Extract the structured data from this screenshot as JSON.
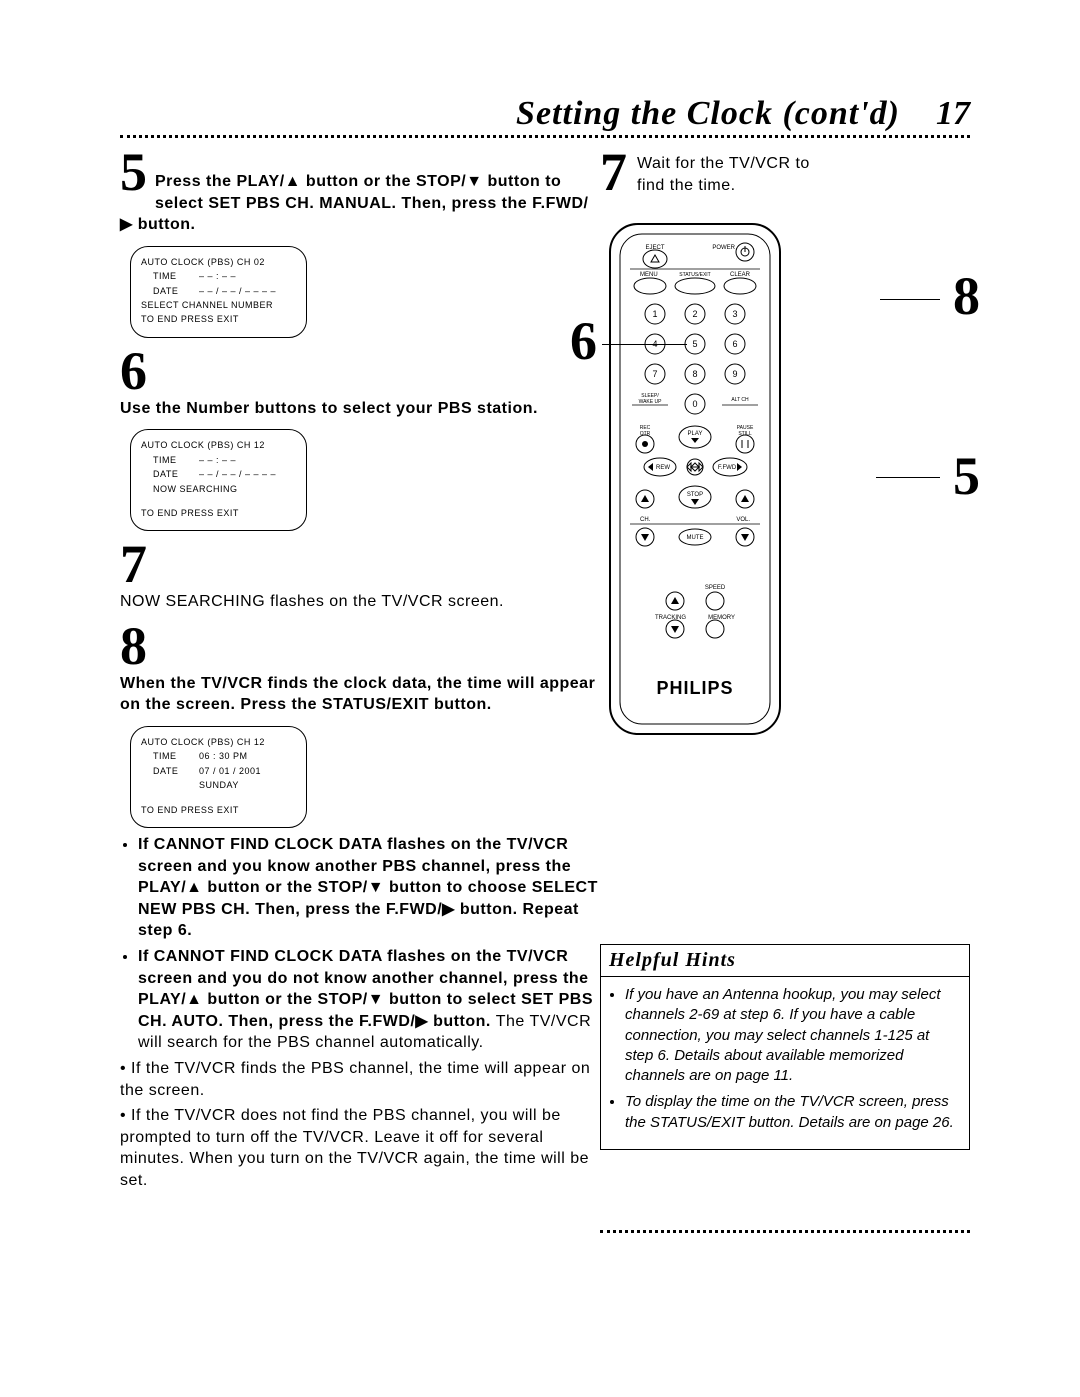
{
  "header": {
    "title": "Setting the Clock (cont'd)",
    "page_num": "17"
  },
  "step5": {
    "num": "5",
    "text": "Press the PLAY/▲ button or the STOP/▼ button to select SET PBS CH. MANUAL. Then, press the F.FWD/▶ button."
  },
  "osd5": {
    "line1": "AUTO CLOCK (PBS) CH 02",
    "time_label": "TIME",
    "time_val": "– – : – –",
    "date_label": "DATE",
    "date_val": "– – / – – / – – – –",
    "line4": "SELECT CHANNEL NUMBER",
    "line5": "TO END PRESS EXIT"
  },
  "step6": {
    "num": "6",
    "text": "Use the Number buttons to select your PBS station."
  },
  "osd6": {
    "line1": "AUTO CLOCK (PBS) CH 12",
    "time_label": "TIME",
    "time_val": "– – : – –",
    "date_label": "DATE",
    "date_val": "– – / – – / – – – –",
    "line4": "NOW SEARCHING",
    "line5": "TO END PRESS EXIT"
  },
  "step7": {
    "num": "7",
    "text": "NOW SEARCHING flashes on the TV/VCR screen."
  },
  "step8": {
    "num": "8",
    "text": "When the TV/VCR finds the clock data, the time will appear on the screen. Press the STATUS/EXIT button."
  },
  "osd8": {
    "line1": "AUTO CLOCK (PBS) CH 12",
    "time_label": "TIME",
    "time_val": "06 : 30 PM",
    "date_label": "DATE",
    "date_val": "07 / 01 / 2001",
    "day": "SUNDAY",
    "line5": "TO END PRESS EXIT"
  },
  "bullets": {
    "b1_bold": "If CANNOT FIND CLOCK DATA flashes on the TV/VCR screen and you know another PBS channel, press the PLAY/▲ button or the STOP/▼ button to choose SELECT NEW PBS CH. Then, press the F.FWD/▶ button. Repeat step 6.",
    "b2_bold": "If CANNOT FIND CLOCK DATA flashes on the TV/VCR screen and you do not know another channel, press the PLAY/▲ button or the STOP/▼ button to select SET PBS CH. AUTO",
    "b2_rest": ". Then, press the F.FWD/▶ button. ",
    "b2_plain": "The TV/VCR will search for the PBS channel automatically.",
    "b3": "• If the TV/VCR finds the PBS channel, the time will appear on the screen.",
    "b4": "• If the TV/VCR does not find the PBS channel, you will be prompted to turn off the TV/VCR. Leave it off for several minutes. When you turn on the TV/VCR again, the time will be set."
  },
  "right": {
    "step7_num": "7",
    "step7_text": "Wait for the TV/VCR to find the time.",
    "callout6": "6",
    "callout8": "8",
    "callout5": "5",
    "brand": "PHILIPS"
  },
  "remote": {
    "eject": "EJECT",
    "power": "POWER",
    "menu": "MENU",
    "status_exit": "STATUS/EXIT",
    "clear": "CLEAR",
    "n1": "1",
    "n2": "2",
    "n3": "3",
    "n4": "4",
    "n5": "5",
    "n6": "6",
    "n7": "7",
    "n8": "8",
    "n9": "9",
    "n0": "0",
    "sleep": "SLEEP/\nWAKE UP",
    "altch": "ALT CH",
    "rec": "REC\nOTR",
    "play": "PLAY",
    "pause": "PAUSE\nSTILL",
    "rew": "REW",
    "ffwd": "F.FWD",
    "stop": "STOP",
    "ch": "CH.",
    "vol": "VOL.",
    "mute": "MUTE",
    "speed": "SPEED",
    "tracking": "TRACKING",
    "memory": "MEMORY"
  },
  "hints": {
    "header": "Helpful Hints",
    "h1": "If you have an Antenna hookup, you may select channels 2-69 at step 6. If you have a cable connection, you may select channels 1-125 at step 6. Details about available memorized channels are on page 11.",
    "h2": "To display the time on the TV/VCR screen, press the STATUS/EXIT button. Details are on page 26."
  }
}
